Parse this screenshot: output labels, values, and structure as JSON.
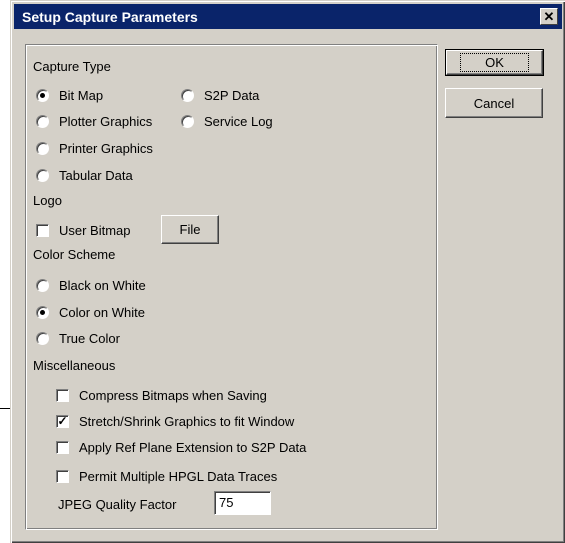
{
  "title": "Setup Capture Parameters",
  "close_glyph": "✕",
  "buttons": {
    "ok": "OK",
    "cancel": "Cancel",
    "file": "File"
  },
  "capture_type": {
    "label": "Capture Type",
    "options": [
      "Bit Map",
      "S2P Data",
      "Plotter Graphics",
      "Service Log",
      "Printer Graphics",
      "Tabular Data"
    ],
    "selected": "Bit Map"
  },
  "logo": {
    "label": "Logo",
    "user_bitmap": "User Bitmap",
    "user_bitmap_checked": false
  },
  "color_scheme": {
    "label": "Color Scheme",
    "options": [
      "Black on White",
      "Color on White",
      "True Color"
    ],
    "selected": "Color on White"
  },
  "misc": {
    "label": "Miscellaneous",
    "options": [
      {
        "label": "Compress Bitmaps when Saving",
        "checked": false
      },
      {
        "label": "Stretch/Shrink Graphics to fit Window",
        "checked": true
      },
      {
        "label": "Apply Ref Plane Extension to S2P Data",
        "checked": false
      },
      {
        "label": "Permit Multiple HPGL Data Traces",
        "checked": false
      }
    ],
    "jpeg_label": "JPEG Quality Factor",
    "jpeg_value": "75"
  },
  "check_glyph": "✓"
}
